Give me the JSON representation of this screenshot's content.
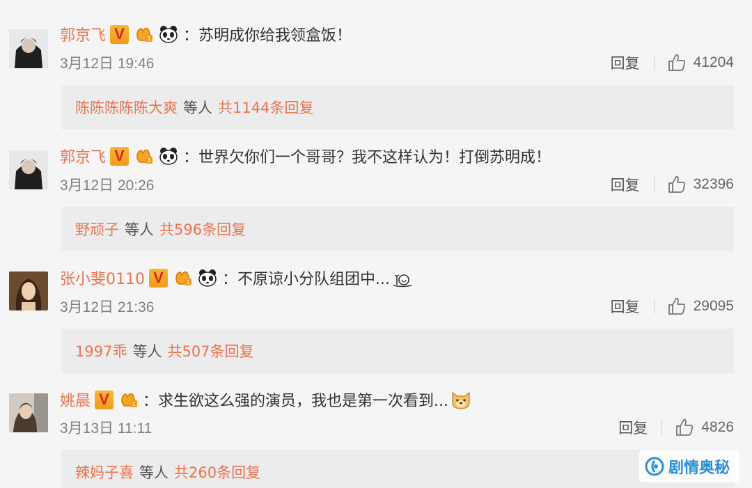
{
  "comments": [
    {
      "username": "郭京飞",
      "badge_v": "V",
      "colon": "：",
      "text": "苏明成你给我领盒饭！",
      "date": "3月12日 19:46",
      "reply_label": "回复",
      "likes": "41204",
      "reply_names": "陈陈陈陈陈大爽",
      "reply_mid": "等人",
      "reply_total": "共1144条回复"
    },
    {
      "username": "郭京飞",
      "badge_v": "V",
      "colon": "：",
      "text": "世界欠你们一个哥哥？我不这样认为！打倒苏明成！",
      "date": "3月12日 20:26",
      "reply_label": "回复",
      "likes": "32396",
      "reply_names": "野顽子",
      "reply_mid": "等人",
      "reply_total": "共596条回复"
    },
    {
      "username": "张小斐0110",
      "badge_v": "V",
      "colon": "：",
      "text": "不原谅小分队组团中...",
      "date": "3月12日 21:36",
      "reply_label": "回复",
      "likes": "29095",
      "reply_names": "1997乖",
      "reply_mid": "等人",
      "reply_total": "共507条回复"
    },
    {
      "username": "姚晨",
      "badge_v": "V",
      "colon": "：",
      "text": "求生欲这么强的演员，我也是第一次看到...",
      "date": "3月13日 11:11",
      "reply_label": "回复",
      "likes": "4826",
      "reply_names": "辣妈子喜",
      "reply_mid": "等人",
      "reply_total": "共260条回复"
    }
  ],
  "watermark": {
    "text": "剧情奥秘"
  },
  "colors": {
    "username": "#eb7350",
    "background": "#f5f5f5",
    "reply_box": "#ececec",
    "meta": "#808080",
    "watermark": "#2a8fd8"
  },
  "icons": [
    "avatar",
    "verified-v-icon",
    "level-hand-icon",
    "panda-emoji-icon",
    "like-thumb-icon",
    "snail-emoji-icon",
    "doge-emoji-icon",
    "watermark-logo-icon"
  ]
}
